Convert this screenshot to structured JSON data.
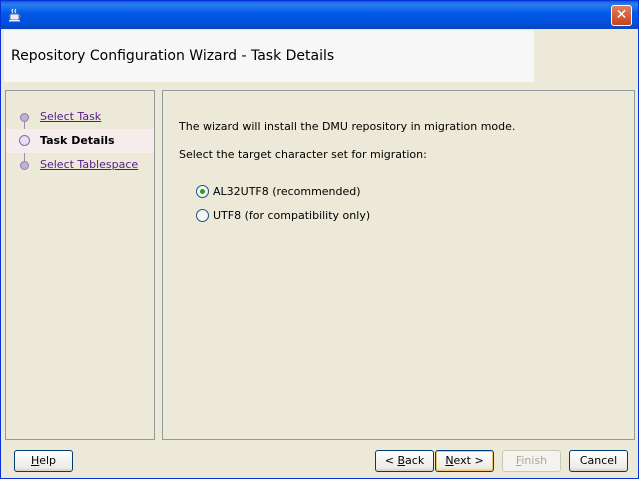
{
  "window": {
    "icon": "java-cup-icon",
    "close_icon": "close-icon",
    "close_glyph": "✕"
  },
  "header": {
    "title": "Repository Configuration Wizard - Task Details"
  },
  "steps": [
    {
      "label": "Select Task",
      "state": "link"
    },
    {
      "label": "Task Details",
      "state": "current"
    },
    {
      "label": "Select Tablespace",
      "state": "link"
    }
  ],
  "main": {
    "line1": "The wizard will install the DMU repository in migration mode.",
    "line2": "Select the target character set for migration:",
    "options": [
      {
        "label": "AL32UTF8 (recommended)",
        "selected": true
      },
      {
        "label": "UTF8 (for compatibility only)",
        "selected": false
      }
    ]
  },
  "buttons": {
    "help": {
      "mnemonic": "H",
      "rest": "elp"
    },
    "back": {
      "prefix": "< ",
      "mnemonic": "B",
      "rest": "ack"
    },
    "next": {
      "mnemonic": "N",
      "rest": "ext >"
    },
    "finish": {
      "mnemonic": "F",
      "rest": "inish",
      "disabled": true
    },
    "cancel": {
      "label": "Cancel"
    }
  },
  "colors": {
    "titlebar": "#0058e6",
    "link": "#551a8b",
    "radio_selected": "#21a121"
  }
}
